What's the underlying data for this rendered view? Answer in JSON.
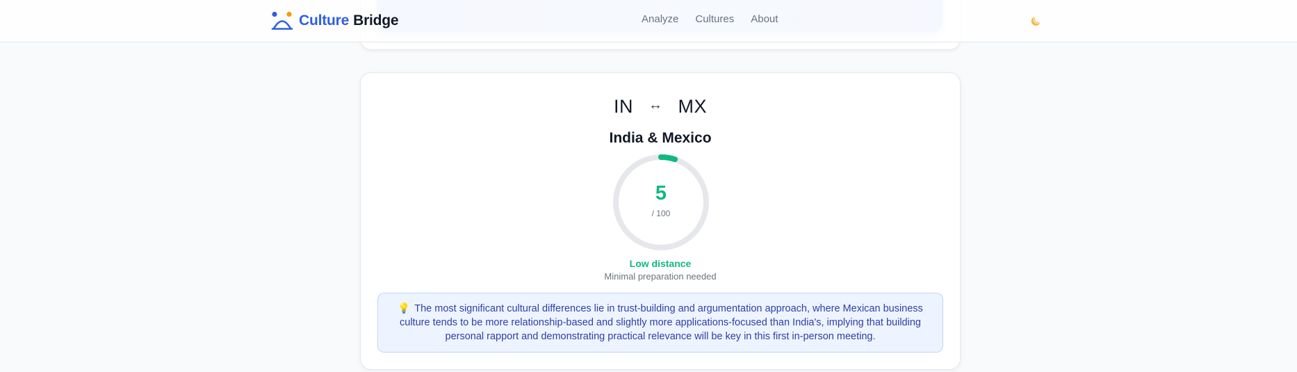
{
  "header": {
    "brand_part1": "Culture",
    "brand_part2": "Bridge",
    "nav": [
      "Analyze",
      "Cultures",
      "About"
    ],
    "theme_icon": "moon-icon"
  },
  "comparison": {
    "code_a": "IN",
    "code_b": "MX",
    "arrow": "↔",
    "title": "India & Mexico",
    "score": "5",
    "score_max": "/ 100",
    "score_fraction": 0.05,
    "level": "Low distance",
    "level_note": "Minimal preparation needed",
    "insight_icon": "lightbulb-icon",
    "insight": "The most significant cultural differences lie in trust-building and argumentation approach, where Mexican business culture tends to be more relationship-based and slightly more applications-focused than India's, implying that building personal rapport and demonstrating practical relevance will be key in this first in-person meeting."
  },
  "colors": {
    "brand": "#2f5fe0",
    "score": "#10b981",
    "gauge_track": "#e5e7eb",
    "insight_bg": "#eef4ff",
    "insight_text": "#2b3fa8"
  }
}
